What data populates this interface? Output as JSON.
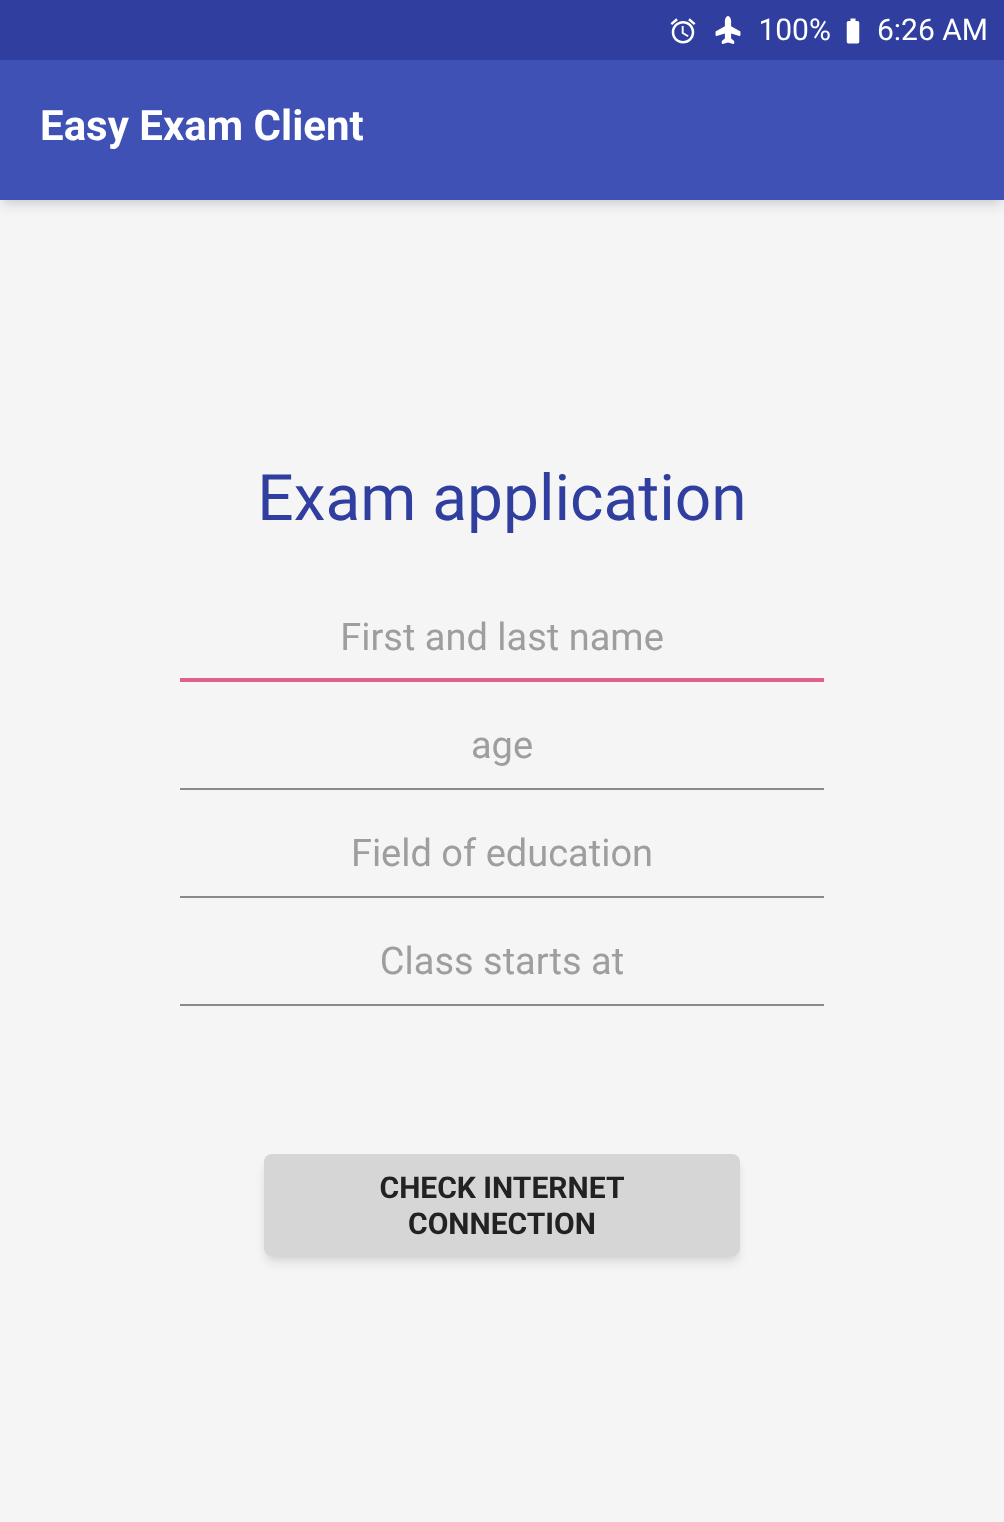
{
  "status_bar": {
    "battery": "100%",
    "time": "6:26 AM"
  },
  "app_bar": {
    "title": "Easy Exam Client"
  },
  "heading": "Exam application",
  "fields": [
    {
      "placeholder": "First and last name",
      "focused": true
    },
    {
      "placeholder": "age",
      "focused": false
    },
    {
      "placeholder": "Field of education",
      "focused": false
    },
    {
      "placeholder": "Class starts at",
      "focused": false
    }
  ],
  "button": "CHECK INTERNET CONNECTION"
}
